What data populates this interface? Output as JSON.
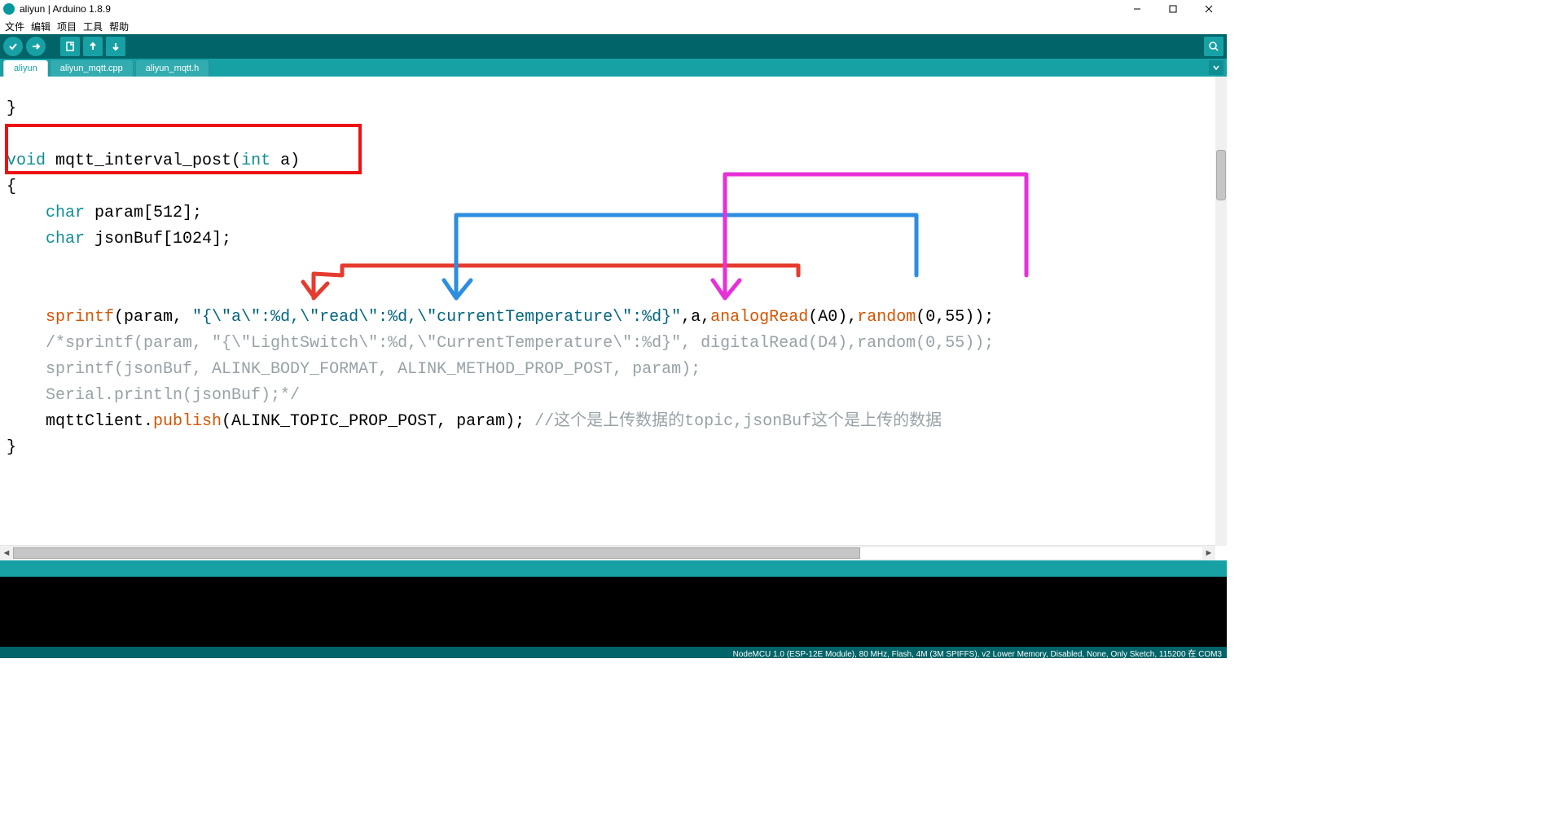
{
  "window": {
    "title": "aliyun | Arduino 1.8.9",
    "minimize": "—",
    "maximize": "❐",
    "close": "✕"
  },
  "menu": {
    "items": [
      "文件",
      "编辑",
      "项目",
      "工具",
      "帮助"
    ]
  },
  "toolbar": {
    "verify": "verify",
    "upload": "upload",
    "new": "new",
    "open": "open",
    "save": "save",
    "serial": "serial-monitor"
  },
  "tabs": {
    "items": [
      {
        "label": "aliyun",
        "active": true
      },
      {
        "label": "aliyun_mqtt.cpp",
        "active": false
      },
      {
        "label": "aliyun_mqtt.h",
        "active": false
      }
    ]
  },
  "code": {
    "l1": "}",
    "l2_void": "void",
    "l2_name": " mqtt_interval_post(",
    "l2_int": "int",
    "l2_rest": " a)",
    "l3": "{",
    "l4_char": "char",
    "l4_rest": " param[512];",
    "l5_char": "char",
    "l5_rest": " jsonBuf[1024];",
    "blank": "",
    "l7_sprintf": "sprintf",
    "l7_open": "(param, ",
    "l7_str": "\"{\\\"a\\\":%d,\\\"read\\\":%d,\\\"currentTemperature\\\":%d}\"",
    "l7_mid": ",a,",
    "l7_aread": "analogRead",
    "l7_a0": "(A0),",
    "l7_rand": "random",
    "l7_end": "(0,55));",
    "l8": "    /*sprintf(param, \"{\\\"LightSwitch\\\":%d,\\\"CurrentTemperature\\\":%d}\", digitalRead(D4),random(0,55));",
    "l9": "    sprintf(jsonBuf, ALINK_BODY_FORMAT, ALINK_METHOD_PROP_POST, param);",
    "l10": "    Serial.println(jsonBuf);*/",
    "l11a": "    mqttClient.",
    "l11_pub": "publish",
    "l11b": "(ALINK_TOPIC_PROP_POST, param); ",
    "l11_cmt": "//这个是上传数据的topic,jsonBuf这个是上传的数据",
    "l12": "}"
  },
  "status": {
    "text": "NodeMCU 1.0 (ESP-12E Module), 80 MHz, Flash, 4M (3M SPIFFS), v2 Lower Memory, Disabled, None, Only Sketch, 115200 在 COM3"
  },
  "scroll": {
    "left_arrow": "◄",
    "right_arrow": "►"
  }
}
